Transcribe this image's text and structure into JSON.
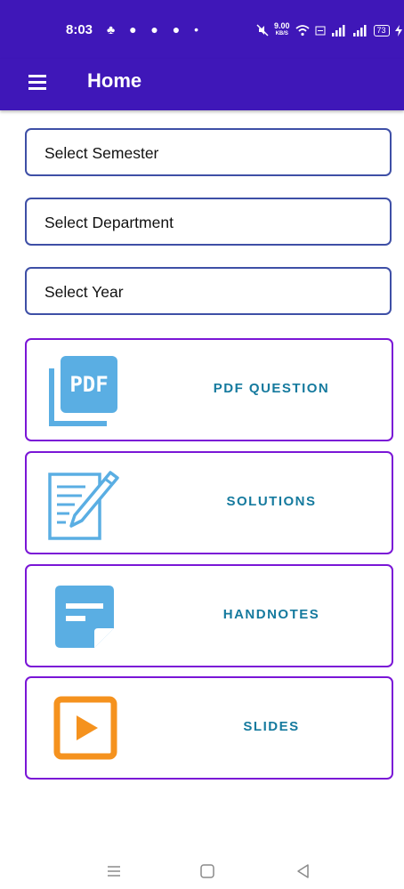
{
  "status_bar": {
    "time": "8:03",
    "left_icons": "♣ ● ● ● •",
    "net_speed_value": "9.00",
    "net_speed_unit": "KB/S",
    "battery": "73"
  },
  "app_bar": {
    "title": "Home"
  },
  "selectors": {
    "semester": "Select Semester",
    "department": "Select Department",
    "year": "Select Year"
  },
  "cards": {
    "pdf_question": "PDF QUESTION",
    "solutions": "SOLUTIONS",
    "handnotes": "HANDNOTES",
    "slides": "SLIDES"
  },
  "icons": {
    "pdf_text": "PDF"
  },
  "colors": {
    "app_bar": "#3f17b8",
    "card_border": "#7a16d6",
    "select_border": "#3e4fa6",
    "card_label": "#157a9e",
    "icon_blue": "#5aaee3",
    "slides_orange": "#f5921e"
  }
}
